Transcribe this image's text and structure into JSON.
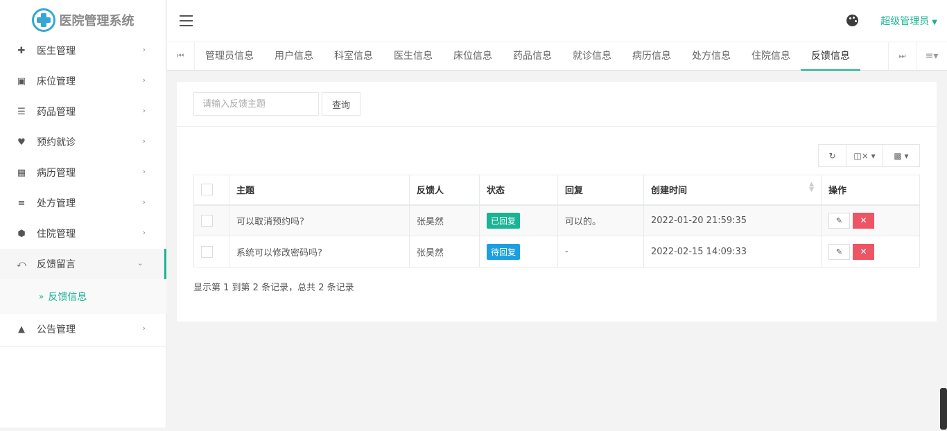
{
  "app": {
    "title": "医院管理系统"
  },
  "sidebar": {
    "items": [
      {
        "label": "医生管理",
        "icon": "user-plus-icon"
      },
      {
        "label": "床位管理",
        "icon": "bed-icon"
      },
      {
        "label": "药品管理",
        "icon": "list-icon"
      },
      {
        "label": "预约就诊",
        "icon": "heartbeat-icon"
      },
      {
        "label": "病历管理",
        "icon": "newspaper-icon"
      },
      {
        "label": "处方管理",
        "icon": "list-check-icon"
      },
      {
        "label": "住院管理",
        "icon": "shield-icon"
      },
      {
        "label": "反馈留言",
        "icon": "reply-all-icon"
      },
      {
        "label": "公告管理",
        "icon": "bullhorn-icon"
      }
    ],
    "submenu": {
      "label": "反馈信息"
    }
  },
  "header": {
    "user": "超级管理员"
  },
  "tabs": [
    "管理员信息",
    "用户信息",
    "科室信息",
    "医生信息",
    "床位信息",
    "药品信息",
    "就诊信息",
    "病历信息",
    "处方信息",
    "住院信息",
    "反馈信息"
  ],
  "search": {
    "placeholder": "请输入反馈主题",
    "button": "查询"
  },
  "table": {
    "headers": [
      "主题",
      "反馈人",
      "状态",
      "回复",
      "创建时间",
      "操作"
    ],
    "rows": [
      {
        "subject": "可以取消预约吗?",
        "user": "张昊然",
        "status": "已回复",
        "reply": "可以的。",
        "created": "2022-01-20 21:59:35"
      },
      {
        "subject": "系统可以修改密码吗?",
        "user": "张昊然",
        "status": "待回复",
        "reply": "-",
        "created": "2022-02-15 14:09:33"
      }
    ]
  },
  "pagination": {
    "info": "显示第 1 到第 2 条记录，总共 2 条记录"
  },
  "colors": {
    "accent": "#1ab394",
    "danger": "#ed5565",
    "pending": "#1c9fe0"
  }
}
